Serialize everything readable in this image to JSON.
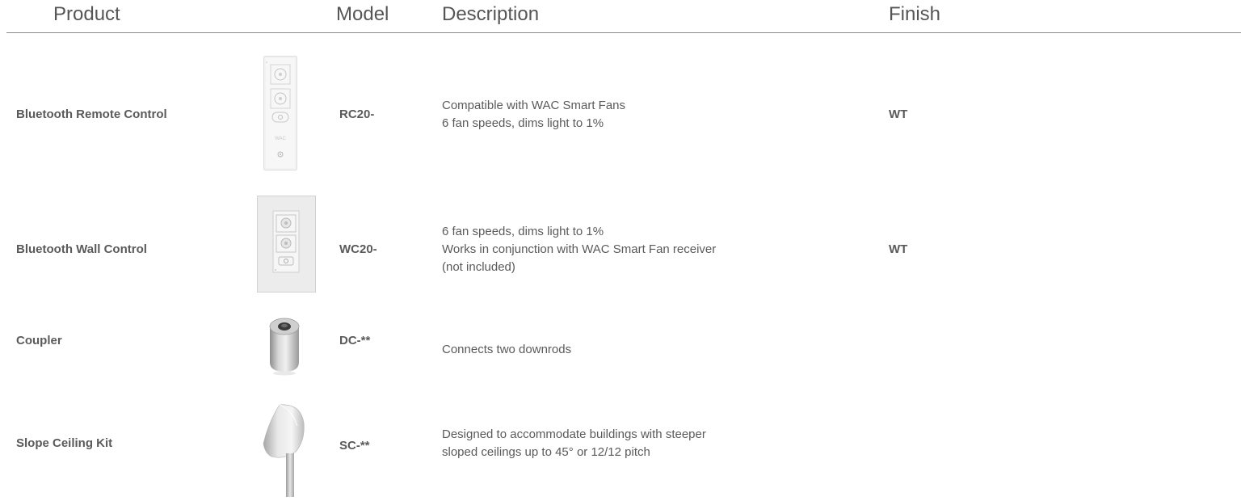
{
  "header": {
    "product": "Product",
    "model": "Model",
    "description": "Description",
    "finish": "Finish"
  },
  "rows": [
    {
      "product": "Bluetooth Remote Control",
      "image": "remote-control-image",
      "model": "RC20-",
      "description": [
        "Compatible with WAC Smart Fans",
        "6 fan speeds, dims light to 1%"
      ],
      "finish": "WT"
    },
    {
      "product": "Bluetooth Wall Control",
      "image": "wall-control-image",
      "model": "WC20-",
      "description": [
        "6 fan speeds, dims light to 1%",
        "Works in conjunction with WAC Smart Fan receiver",
        "(not included)"
      ],
      "finish": "WT"
    },
    {
      "product": "Coupler",
      "image": "coupler-image",
      "model": "DC-**",
      "description": [
        "Connects two downrods"
      ],
      "finish": ""
    },
    {
      "product": "Slope Ceiling Kit",
      "image": "slope-ceiling-kit-image",
      "model": "SC-**",
      "description": [
        "Designed to accommodate buildings with steeper",
        "sloped ceilings up to 45° or 12/12 pitch"
      ],
      "finish": ""
    }
  ],
  "remote_logo_text": "WAC"
}
